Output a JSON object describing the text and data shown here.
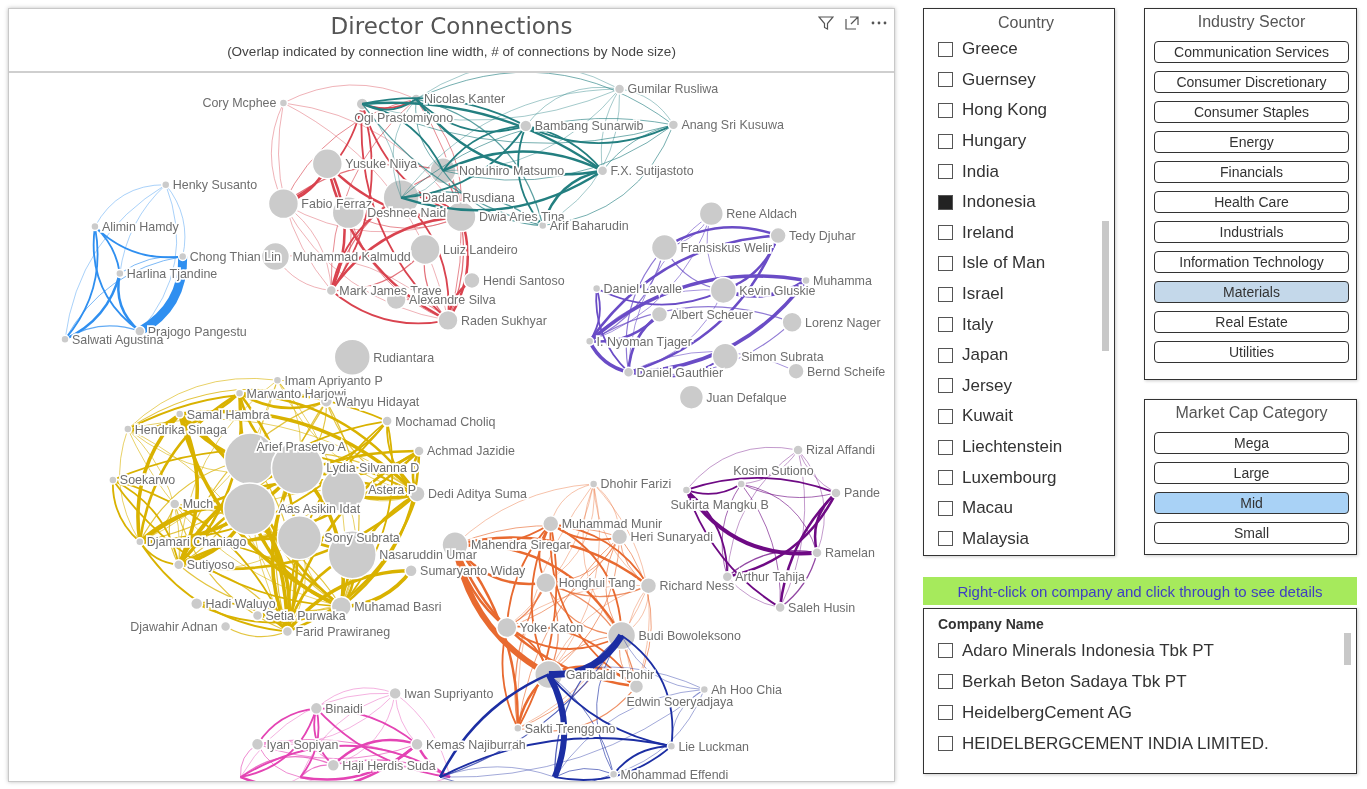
{
  "visual": {
    "title": "Director Connections",
    "subtitle": "(Overlap indicated by connection line width, # of connections by Node size)",
    "graph": {
      "clusters": [
        {
          "color": "#2f8ff0",
          "directors": [
            {
              "name": "Henky Susanto"
            },
            {
              "name": "Alimin Hamdy"
            },
            {
              "name": "Chong Thian Lin"
            },
            {
              "name": "Harlina Tjandine"
            },
            {
              "name": "Prajogo Pangestu"
            },
            {
              "name": "Salwati Agustina"
            }
          ]
        },
        {
          "color": "#d9434f",
          "directors": [
            {
              "name": "Cory Mcphee"
            },
            {
              "name": "Ogi Prastomiyono"
            },
            {
              "name": "Nicolas Kanter"
            },
            {
              "name": "Yusuke Niiya"
            },
            {
              "name": "Nobuhiro Matsumo"
            },
            {
              "name": "Fabio Ferraz"
            },
            {
              "name": "Dadan Rusdiana"
            },
            {
              "name": "Deshnee Naid"
            },
            {
              "name": "Dwia Aries Tina"
            },
            {
              "name": "Luiz Landeiro"
            },
            {
              "name": "Muhammad Kalmudd"
            },
            {
              "name": "Mark James Trave"
            },
            {
              "name": "Alexandre Silva"
            },
            {
              "name": "Hendi Santoso"
            },
            {
              "name": "Raden Sukhyar"
            },
            {
              "name": "Rudiantara"
            }
          ]
        },
        {
          "color": "#237f80",
          "directors": [
            {
              "name": "Gumilar Rusliwa"
            },
            {
              "name": "Bambang Sunarwib"
            },
            {
              "name": "Anang Sri Kusuwa"
            },
            {
              "name": "F.X. Sutijastoto"
            },
            {
              "name": "Arif Baharudin"
            }
          ]
        },
        {
          "color": "#6a4cc6",
          "directors": [
            {
              "name": "Rene Aldach"
            },
            {
              "name": "Tedy Djuhar"
            },
            {
              "name": "Fransiskus Welir"
            },
            {
              "name": "Muhamma"
            },
            {
              "name": "Daniel Lavalle"
            },
            {
              "name": "Kevin Gluskie"
            },
            {
              "name": "Albert Scheuer"
            },
            {
              "name": "Lorenz Nager"
            },
            {
              "name": "I. Nyoman Tjager"
            },
            {
              "name": "Simon Subrata"
            },
            {
              "name": "Bernd Scheife"
            },
            {
              "name": "Daniel Gauthier"
            },
            {
              "name": "Juan Defalque"
            }
          ]
        },
        {
          "color": "#d9b200",
          "directors": [
            {
              "name": "Imam Apriyanto P"
            },
            {
              "name": "Marwanto Harjowi"
            },
            {
              "name": "Wahyu Hidayat"
            },
            {
              "name": "Samal Hambra"
            },
            {
              "name": "Mochamad Choliq"
            },
            {
              "name": "Hendrika Sinaga"
            },
            {
              "name": "Achmad Jazidie"
            },
            {
              "name": "Arief Prasetyo A"
            },
            {
              "name": "Lydia Silvanna D"
            },
            {
              "name": "Soekarwo"
            },
            {
              "name": "Astera P"
            },
            {
              "name": "Dedi Aditya Suma"
            },
            {
              "name": "Much"
            },
            {
              "name": "Aas Asikin Idat"
            },
            {
              "name": "Djamari Chaniago"
            },
            {
              "name": "Sony Subrata"
            },
            {
              "name": "Nasaruddin Umar"
            },
            {
              "name": "Sutiyoso"
            },
            {
              "name": "Sumaryanto Widay"
            },
            {
              "name": "Hadi Waluyo"
            },
            {
              "name": "Muhamad Basri"
            },
            {
              "name": "Setia Purwaka"
            },
            {
              "name": "Djawahir Adnan"
            },
            {
              "name": "Farid Prawiraneg"
            }
          ]
        },
        {
          "color": "#e86a30",
          "directors": [
            {
              "name": "Dhohir Farizi"
            },
            {
              "name": "Muhammad Munir"
            },
            {
              "name": "Heri Sunaryadi"
            },
            {
              "name": "Mahendra Siregar"
            },
            {
              "name": "Honghui Tang"
            },
            {
              "name": "Richard Ness"
            },
            {
              "name": "Yoke Katon"
            },
            {
              "name": "Budi Bowoleksono"
            },
            {
              "name": "Garibaldi Thohir"
            },
            {
              "name": "Sakti Trenggono"
            },
            {
              "name": "Edwin Soeryadjaya"
            }
          ]
        },
        {
          "color": "#6e0a84",
          "directors": [
            {
              "name": "Rizal Affandi"
            },
            {
              "name": "Sukirta Mangku B"
            },
            {
              "name": "Kosim Sutiono"
            },
            {
              "name": "Pande"
            },
            {
              "name": "Ramelan"
            },
            {
              "name": "Arthur Tahija"
            },
            {
              "name": "Saleh Husin"
            }
          ]
        },
        {
          "color": "#e444b4",
          "directors": [
            {
              "name": "Iwan Supriyanto"
            },
            {
              "name": "Binaidi"
            },
            {
              "name": "Iyan Sopiyan"
            },
            {
              "name": "Kemas Najiburrah"
            },
            {
              "name": "Haji Herdis Suda"
            }
          ]
        },
        {
          "color": "#1c2ea3",
          "directors": [
            {
              "name": "Ah Hoo Chia"
            },
            {
              "name": "Lie Luckman"
            },
            {
              "name": "Mohammad Effendi"
            }
          ]
        }
      ]
    }
  },
  "country": {
    "title": "Country",
    "items": [
      {
        "label": "Greece",
        "checked": false
      },
      {
        "label": "Guernsey",
        "checked": false
      },
      {
        "label": "Hong Kong",
        "checked": false
      },
      {
        "label": "Hungary",
        "checked": false
      },
      {
        "label": "India",
        "checked": false
      },
      {
        "label": "Indonesia",
        "checked": true
      },
      {
        "label": "Ireland",
        "checked": false
      },
      {
        "label": "Isle of Man",
        "checked": false
      },
      {
        "label": "Israel",
        "checked": false
      },
      {
        "label": "Italy",
        "checked": false
      },
      {
        "label": "Japan",
        "checked": false
      },
      {
        "label": "Jersey",
        "checked": false
      },
      {
        "label": "Kuwait",
        "checked": false
      },
      {
        "label": "Liechtenstein",
        "checked": false
      },
      {
        "label": "Luxembourg",
        "checked": false
      },
      {
        "label": "Macau",
        "checked": false
      },
      {
        "label": "Malaysia",
        "checked": false
      }
    ]
  },
  "industry": {
    "title": "Industry Sector",
    "items": [
      {
        "label": "Communication Services",
        "selected": false
      },
      {
        "label": "Consumer Discretionary",
        "selected": false
      },
      {
        "label": "Consumer Staples",
        "selected": false
      },
      {
        "label": "Energy",
        "selected": false
      },
      {
        "label": "Financials",
        "selected": false
      },
      {
        "label": "Health Care",
        "selected": false
      },
      {
        "label": "Industrials",
        "selected": false
      },
      {
        "label": "Information Technology",
        "selected": false
      },
      {
        "label": "Materials",
        "selected": true
      },
      {
        "label": "Real Estate",
        "selected": false
      },
      {
        "label": "Utilities",
        "selected": false
      }
    ]
  },
  "market_cap": {
    "title": "Market Cap Category",
    "items": [
      {
        "label": "Mega",
        "selected": false
      },
      {
        "label": "Large",
        "selected": false
      },
      {
        "label": "Mid",
        "selected": true
      },
      {
        "label": "Small",
        "selected": false
      }
    ]
  },
  "banner": "Right-click on company and click through to see details",
  "companies": {
    "column": "Company Name",
    "rows": [
      {
        "name": "Adaro Minerals Indonesia Tbk PT",
        "checked": false
      },
      {
        "name": "Berkah Beton Sadaya Tbk PT",
        "checked": false
      },
      {
        "name": "HeidelbergCement AG",
        "checked": false
      },
      {
        "name": "HEIDELBERGCEMENT INDIA LIMITED.",
        "checked": false
      }
    ]
  }
}
